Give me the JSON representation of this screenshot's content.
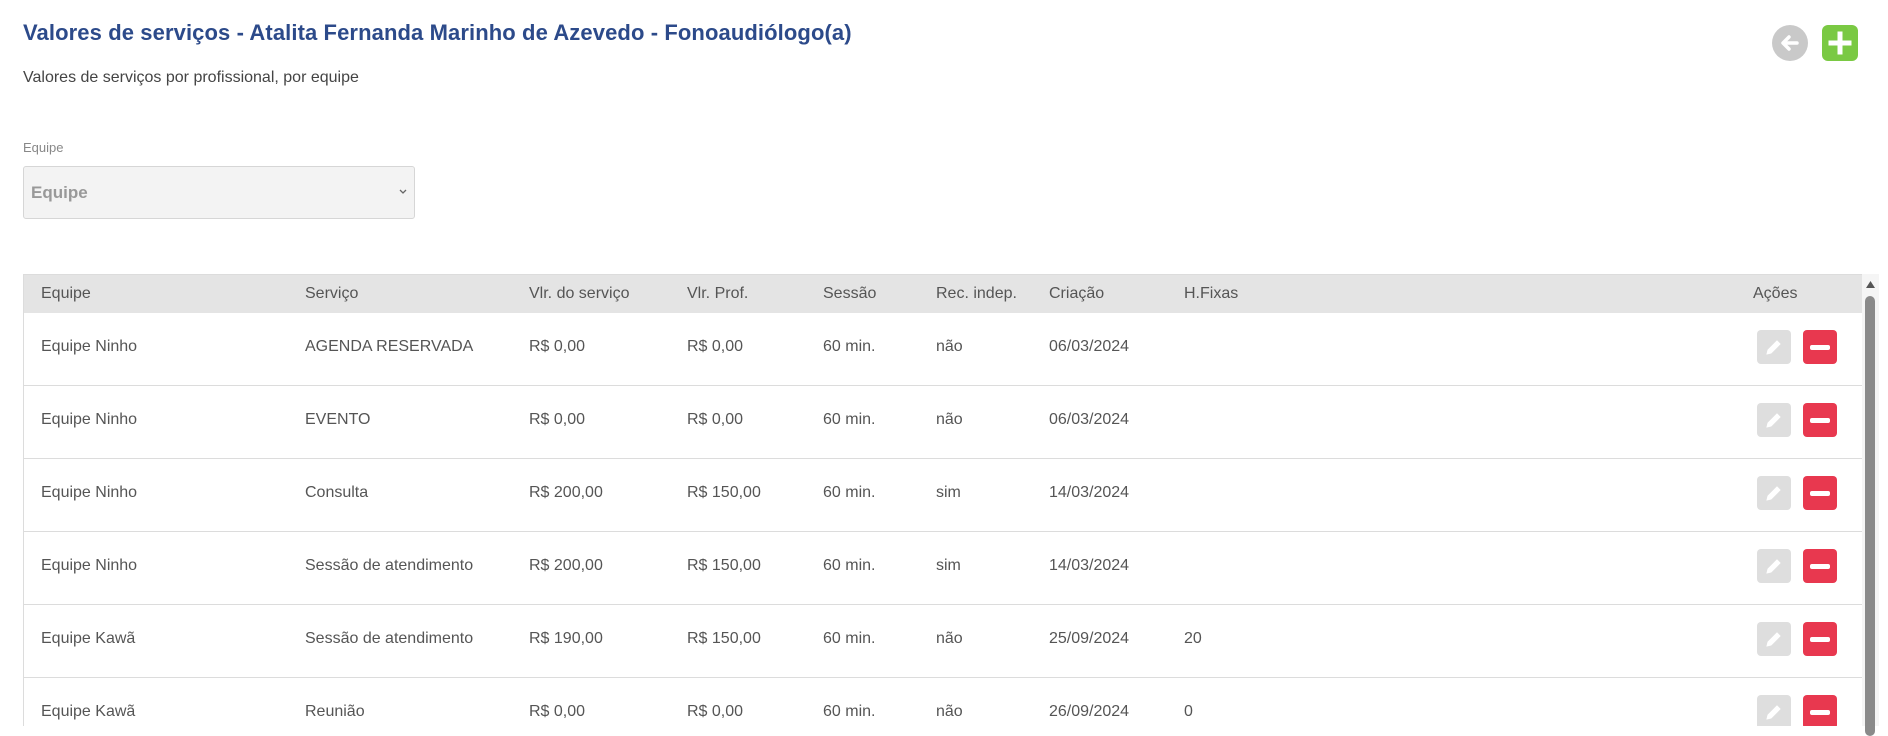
{
  "header": {
    "title": "Valores de serviços - Atalita Fernanda Marinho de Azevedo - Fonoaudiólogo(a)",
    "subtitle": "Valores de serviços por profissional, por equipe"
  },
  "filter": {
    "label": "Equipe",
    "selected": "Equipe"
  },
  "table": {
    "columns": {
      "equipe": "Equipe",
      "servico": "Serviço",
      "vlr_servico": "Vlr. do serviço",
      "vlr_prof": "Vlr. Prof.",
      "sessao": "Sessão",
      "rec_indep": "Rec. indep.",
      "criacao": "Criação",
      "hfixas": "H.Fixas",
      "acoes": "Ações"
    },
    "rows": [
      {
        "equipe": "Equipe Ninho",
        "servico": "AGENDA RESERVADA",
        "vlr_servico": "R$ 0,00",
        "vlr_prof": "R$ 0,00",
        "sessao": "60 min.",
        "rec_indep": "não",
        "criacao": "06/03/2024",
        "hfixas": ""
      },
      {
        "equipe": "Equipe Ninho",
        "servico": "EVENTO",
        "vlr_servico": "R$ 0,00",
        "vlr_prof": "R$ 0,00",
        "sessao": "60 min.",
        "rec_indep": "não",
        "criacao": "06/03/2024",
        "hfixas": ""
      },
      {
        "equipe": "Equipe Ninho",
        "servico": "Consulta",
        "vlr_servico": "R$ 200,00",
        "vlr_prof": "R$ 150,00",
        "sessao": "60 min.",
        "rec_indep": "sim",
        "criacao": "14/03/2024",
        "hfixas": ""
      },
      {
        "equipe": "Equipe Ninho",
        "servico": "Sessão de atendimento",
        "vlr_servico": "R$ 200,00",
        "vlr_prof": "R$ 150,00",
        "sessao": "60 min.",
        "rec_indep": "sim",
        "criacao": "14/03/2024",
        "hfixas": ""
      },
      {
        "equipe": "Equipe Kawã",
        "servico": "Sessão de atendimento",
        "vlr_servico": "R$ 190,00",
        "vlr_prof": "R$ 150,00",
        "sessao": "60 min.",
        "rec_indep": "não",
        "criacao": "25/09/2024",
        "hfixas": "20"
      },
      {
        "equipe": "Equipe Kawã",
        "servico": "Reunião",
        "vlr_servico": "R$ 0,00",
        "vlr_prof": "R$ 0,00",
        "sessao": "60 min.",
        "rec_indep": "não",
        "criacao": "26/09/2024",
        "hfixas": "0"
      }
    ]
  },
  "icons": {
    "back": "arrow-left-icon",
    "add": "plus-icon",
    "edit": "pencil-icon",
    "delete": "minus-icon",
    "select": "chevron-down-icon"
  },
  "colors": {
    "title": "#2c4a8a",
    "add_button": "#7ac943",
    "delete_button": "#e8384f",
    "edit_button": "#dedede",
    "header_bg": "#e4e4e4"
  }
}
